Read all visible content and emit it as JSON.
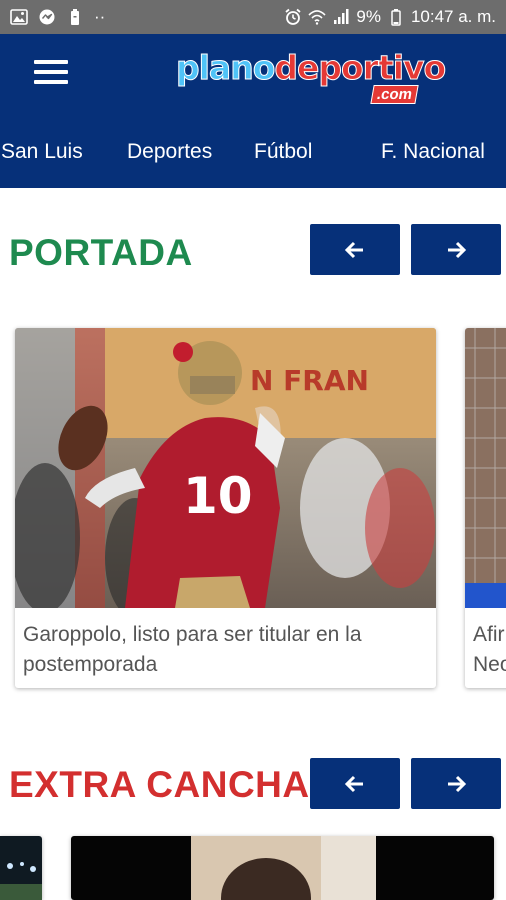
{
  "status_bar": {
    "battery": "9%",
    "time": "10:47 a. m.",
    "dots": "··"
  },
  "header": {
    "logo_part1": "plano",
    "logo_part2": "deportivo",
    "logo_suffix": ".com",
    "nav": [
      "San Luis",
      "Deportes",
      "Fútbol",
      "F. Nacional"
    ]
  },
  "sections": [
    {
      "title": "PORTADA",
      "title_color": "#1e8a4f",
      "articles": [
        {
          "title": "Garoppolo, listo para ser titular en la postemporada",
          "jersey_number": "10"
        },
        {
          "title": "Afir Neo"
        }
      ]
    },
    {
      "title": "EXTRA CANCHA",
      "title_color": "#d32f2f"
    }
  ],
  "colors": {
    "brand_blue": "#063079",
    "status_gray": "#6d6d6d"
  }
}
